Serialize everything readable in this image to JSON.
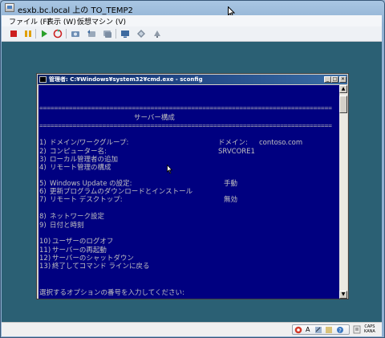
{
  "window": {
    "title": "esxb.bc.local 上の TO_TEMP2"
  },
  "menu": {
    "items": [
      {
        "label": "ファイル (F)"
      },
      {
        "label": "表示 (W)"
      },
      {
        "label": "仮想マシン (V)"
      }
    ]
  },
  "toolbar": {
    "icons": [
      "stop-icon",
      "pause-icon",
      "play-icon",
      "reset-icon",
      "snapshot-icon",
      "revert-snapshot-icon",
      "snapshot-manager-icon",
      "console-icon",
      "devices-icon",
      "network-icon"
    ]
  },
  "console": {
    "title": "管理者: C:¥Windows¥system32¥cmd.exe - sconfig",
    "rule": "===============================================================================",
    "heading": "サーバー構成",
    "menu": [
      {
        "num": "1)",
        "label": "ドメイン/ワークグループ:",
        "value_label": "ドメイン:",
        "value": "contoso.com"
      },
      {
        "num": "2)",
        "label": "コンピューター名:",
        "value": "SRVCORE1"
      },
      {
        "num": "3)",
        "label": "ローカル管理者の追加"
      },
      {
        "num": "4)",
        "label": "リモート管理の構成"
      },
      {
        "num": "5)",
        "label": "Windows Update の設定:",
        "value": "手動"
      },
      {
        "num": "6)",
        "label": "更新プログラムのダウンロードとインストール"
      },
      {
        "num": "7)",
        "label": "リモート デスクトップ:",
        "value": "無効"
      },
      {
        "num": "8)",
        "label": "ネットワーク設定"
      },
      {
        "num": "9)",
        "label": "日付と時刻"
      },
      {
        "num": "10)",
        "label": "ユーザーのログオフ"
      },
      {
        "num": "11)",
        "label": "サーバーの再起動"
      },
      {
        "num": "12)",
        "label": "サーバーのシャットダウン"
      },
      {
        "num": "13)",
        "label": "終了してコマンド ラインに戻る"
      }
    ],
    "prompt": "選択するオプションの番号を入力してください:"
  },
  "statusbar": {
    "ime_mode": "A",
    "caps": "CAPS",
    "kana": "KANA"
  },
  "colors": {
    "console_bg": "#000080",
    "console_fg": "#c0c0c0",
    "viewport_bg": "#2b6074"
  }
}
